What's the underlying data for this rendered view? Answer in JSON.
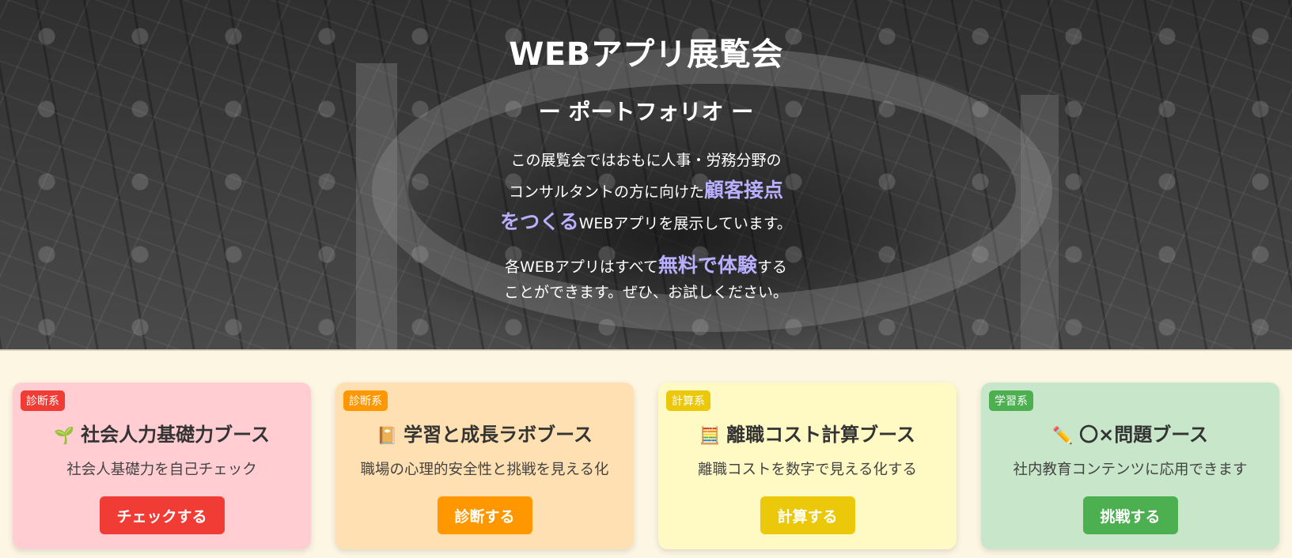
{
  "hero": {
    "title": "WEBアプリ展覧会",
    "subtitle": "ー ポートフォリオ ー",
    "intro_line1": "この展覧会ではおもに人事・労務分野の",
    "intro_line2_pre": "コンサルタントの方に向けた",
    "intro_highlight_a": "顧客接点",
    "intro_highlight_b": "をつくる",
    "intro_line3_post": "WEBアプリを展示しています。",
    "free_pre": "各WEBアプリはすべて",
    "free_highlight": "無料で体験",
    "free_post": "する",
    "free_line2": "ことができます。ぜひ、お試しください。"
  },
  "booths": [
    {
      "tag": "診断系",
      "icon": "seedling-icon",
      "emoji": "🌱",
      "title": "社会人力基礎力ブース",
      "description": "社会人基礎力を自己チェック",
      "button": "チェックする",
      "color": "#f13c35"
    },
    {
      "tag": "診断系",
      "icon": "notebook-icon",
      "emoji": "📔",
      "title": "学習と成長ラボブース",
      "description": "職場の心理的安全性と挑戦を見える化",
      "button": "診断する",
      "color": "#ff9800"
    },
    {
      "tag": "計算系",
      "icon": "abacus-icon",
      "emoji": "🧮",
      "title": "離職コスト計算ブース",
      "description": "離職コストを数字で見える化する",
      "button": "計算する",
      "color": "#ebc90a"
    },
    {
      "tag": "学習系",
      "icon": "pencil-icon",
      "emoji": "✏️",
      "title": "〇×問題ブース",
      "description": "社内教育コンテンツに応用できます",
      "button": "挑戦する",
      "color": "#4caf50"
    }
  ]
}
